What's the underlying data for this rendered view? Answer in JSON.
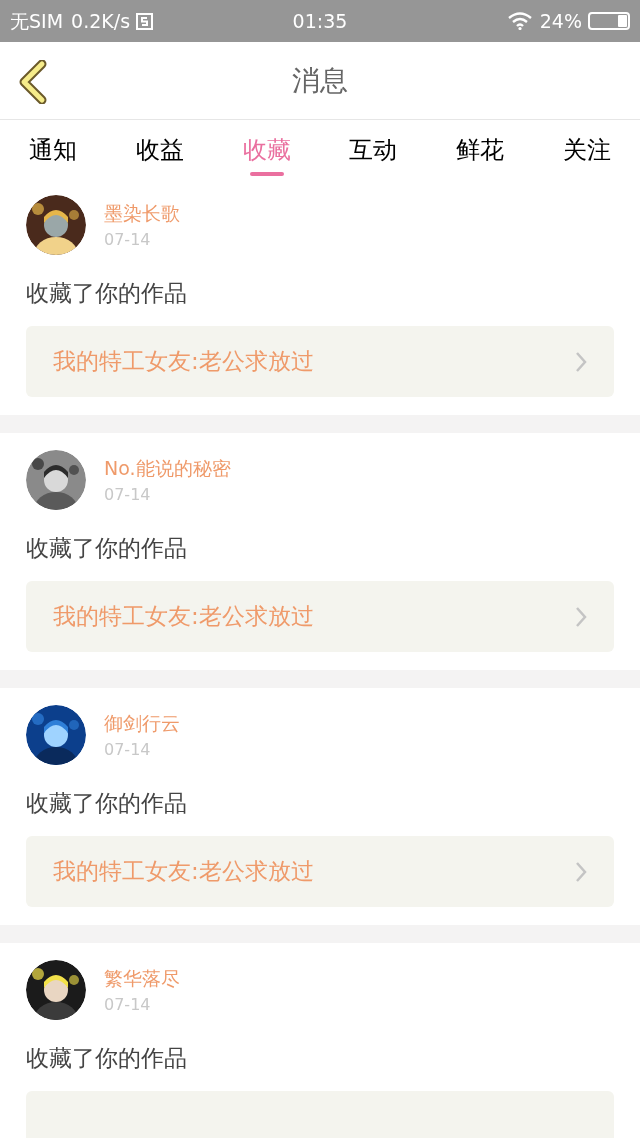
{
  "status_bar": {
    "carrier": "无SIM",
    "speed": "0.2K/s",
    "time": "01:35",
    "battery_text": "24%"
  },
  "header": {
    "title": "消息"
  },
  "tabs": [
    {
      "label": "通知",
      "selected": false
    },
    {
      "label": "收益",
      "selected": false
    },
    {
      "label": "收藏",
      "selected": true
    },
    {
      "label": "互动",
      "selected": false
    },
    {
      "label": "鲜花",
      "selected": false
    },
    {
      "label": "关注",
      "selected": false
    }
  ],
  "messages": [
    {
      "user": "墨染长歌",
      "date": "07-14",
      "text": "收藏了你的作品",
      "book": "我的特工女友:老公求放过"
    },
    {
      "user": "No.能说的秘密",
      "date": "07-14",
      "text": "收藏了你的作品",
      "book": "我的特工女友:老公求放过"
    },
    {
      "user": "御剑行云",
      "date": "07-14",
      "text": "收藏了你的作品",
      "book": "我的特工女友:老公求放过"
    },
    {
      "user": "繁华落尽",
      "date": "07-14",
      "text": "收藏了你的作品"
    }
  ]
}
